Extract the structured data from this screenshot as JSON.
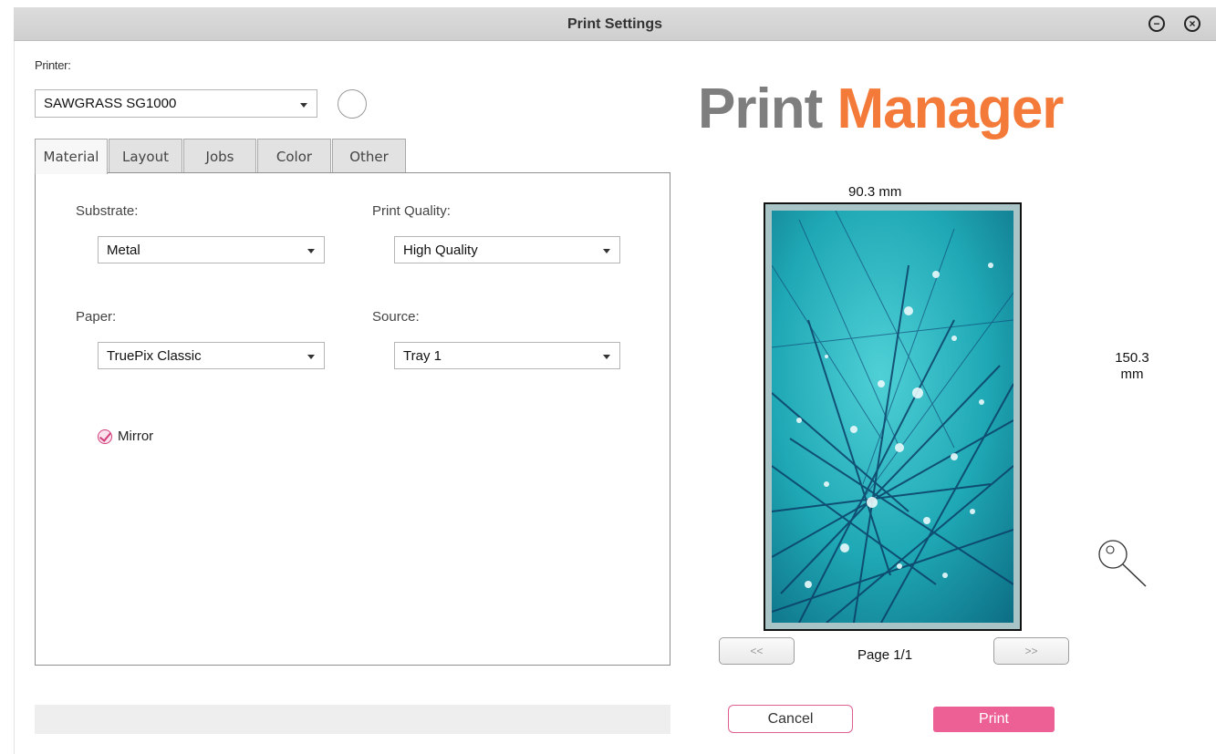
{
  "window": {
    "title": "Print Settings",
    "minimize_icon": "minus-circle-icon",
    "close_icon": "x-circle-icon"
  },
  "printer": {
    "label": "Printer:",
    "selected": "SAWGRASS SG1000",
    "status_icon": "status-circle-icon"
  },
  "tabs": [
    {
      "label": "Material",
      "active": true
    },
    {
      "label": "Layout",
      "active": false
    },
    {
      "label": "Jobs",
      "active": false
    },
    {
      "label": "Color",
      "active": false
    },
    {
      "label": "Other",
      "active": false
    }
  ],
  "material": {
    "substrate": {
      "label": "Substrate:",
      "value": "Metal"
    },
    "print_quality": {
      "label": "Print Quality:",
      "value": "High Quality"
    },
    "paper": {
      "label": "Paper:",
      "value": "TruePix Classic"
    },
    "source": {
      "label": "Source:",
      "value": "Tray 1"
    },
    "mirror": {
      "label": "Mirror",
      "checked": true
    }
  },
  "progress": {
    "value": 0
  },
  "brand": {
    "word1": "Print",
    "word2": "Manager",
    "color1": "#7e7e7e",
    "color2": "#f47a3a"
  },
  "preview": {
    "width_label": "90.3 mm",
    "height_value": "150.3",
    "height_unit": "mm",
    "zoom_icon": "zoom-icon"
  },
  "pagination": {
    "prev_label": "<<",
    "next_label": ">>",
    "page_label": "Page 1/1"
  },
  "actions": {
    "cancel_label": "Cancel",
    "print_label": "Print",
    "accent_color": "#ed6096"
  }
}
